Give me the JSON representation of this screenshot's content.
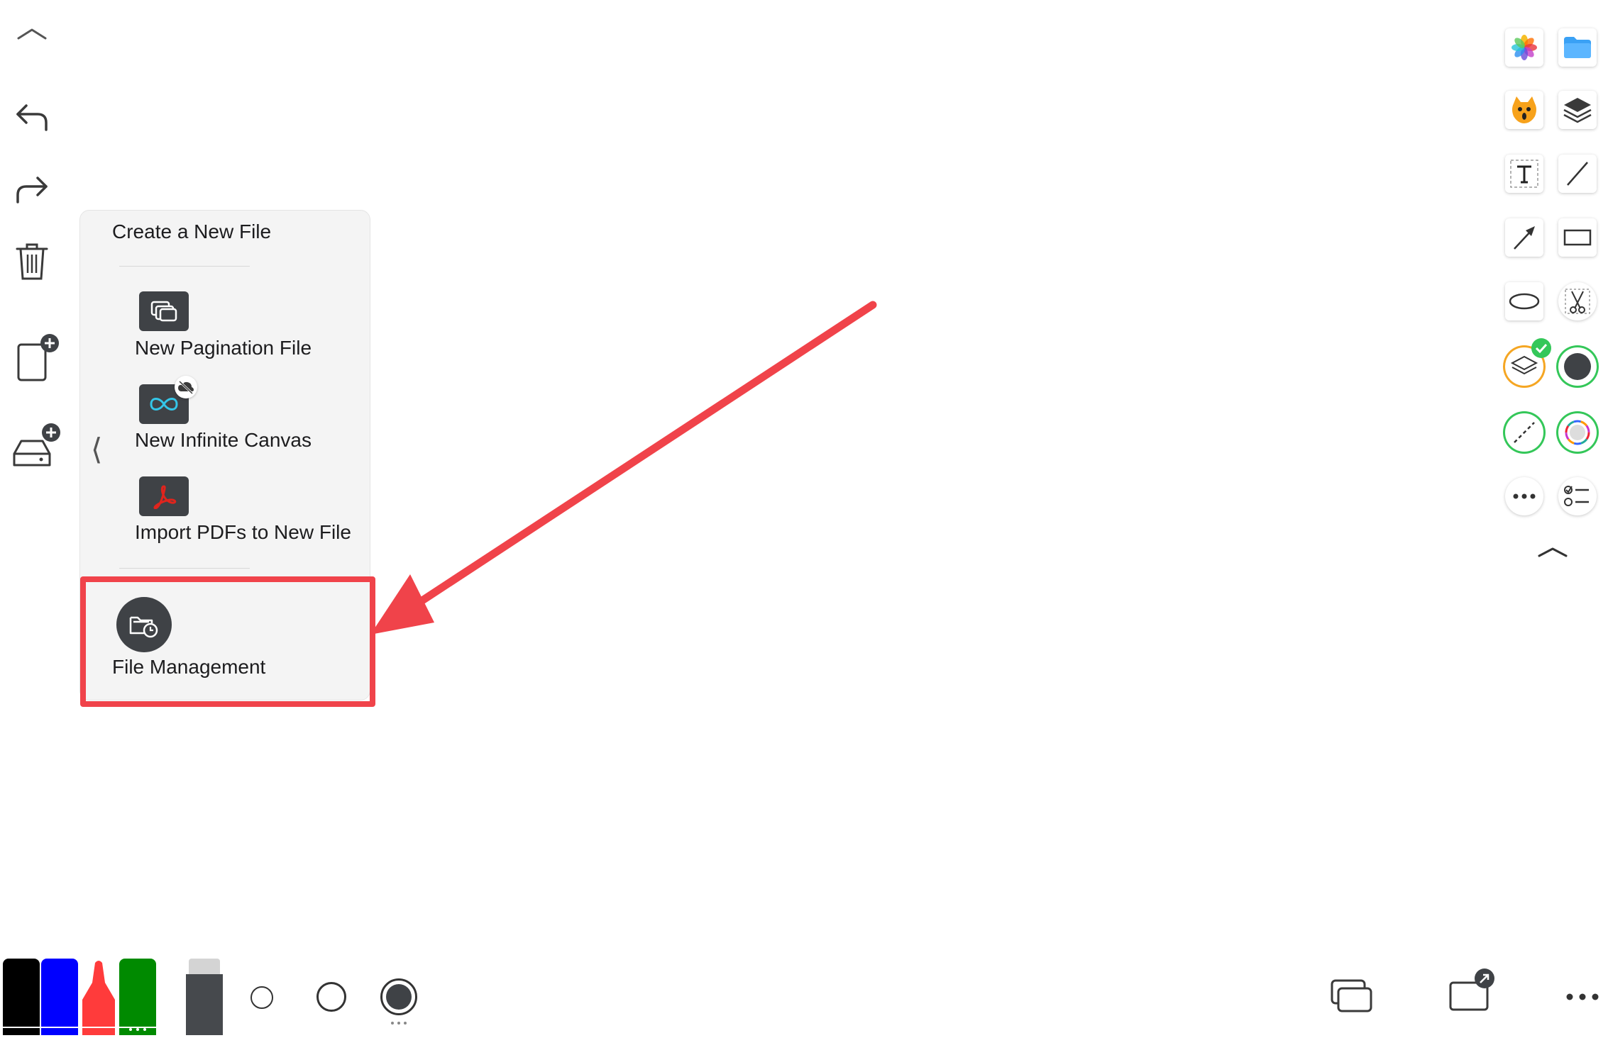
{
  "menu": {
    "header": "Create a New File",
    "items": [
      {
        "label": "New Pagination File",
        "icon": "pages-icon"
      },
      {
        "label": "New Infinite Canvas",
        "icon": "infinity-icon"
      },
      {
        "label": "Import PDFs to New File",
        "icon": "pdf-icon"
      }
    ],
    "file_management": "File Management",
    "back_glyph": "⟨"
  },
  "colors": {
    "highlight": "#f0434a",
    "menu_bg": "#f4f4f4",
    "icon_dark": "#3f4246",
    "marker_black": "#000000",
    "marker_blue": "#0000ff",
    "marker_red": "#ff3b3b",
    "marker_green": "#008a00",
    "check_green": "#34c759"
  },
  "left_toolbar": [
    "collapse-chevron-icon",
    "undo-icon",
    "redo-icon",
    "trash-icon",
    "add-page-icon",
    "add-storage-icon"
  ],
  "right_palette": [
    "photos-icon",
    "folder-icon",
    "sticker-icon",
    "layers-icon",
    "text-box-icon",
    "line-icon",
    "arrow-icon",
    "rectangle-icon",
    "ellipse-icon",
    "scissors-icon",
    "layer-select-icon",
    "fill-color-icon",
    "dashed-line-icon",
    "color-wheel-icon",
    "more-icon",
    "checklist-icon",
    "collapse-chevron-icon"
  ],
  "bottom_toolbar": [
    "black-marker",
    "blue-marker",
    "red-marker",
    "green-marker",
    "eraser",
    "small-dot-size",
    "medium-dot-size",
    "large-dot-size",
    "pages-icon",
    "share-icon",
    "more-icon"
  ]
}
